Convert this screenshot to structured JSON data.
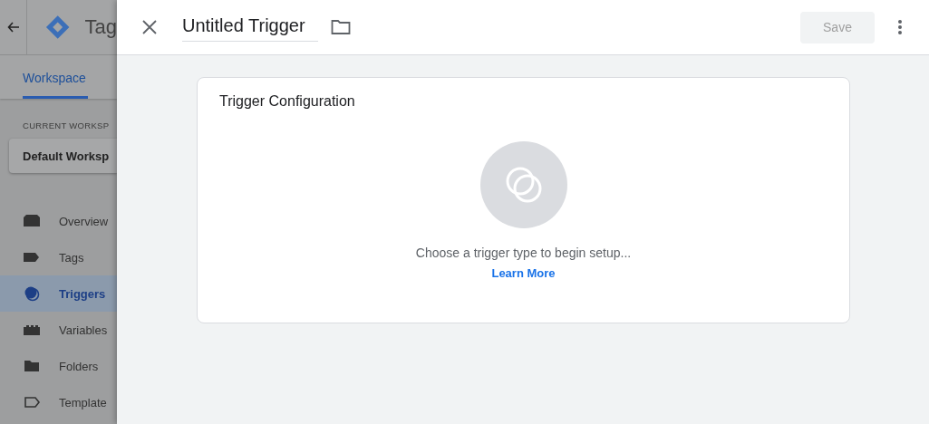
{
  "background_app": {
    "product_name": "Tag",
    "tabs": [
      {
        "label": "Workspace",
        "selected": true
      }
    ],
    "current_workspace_label": "CURRENT WORKSP",
    "workspace_name": "Default Worksp",
    "items": [
      {
        "label": "Overview",
        "kind": "overview",
        "selected": false
      },
      {
        "label": "Tags",
        "kind": "tags",
        "selected": false
      },
      {
        "label": "Triggers",
        "kind": "triggers",
        "selected": true
      },
      {
        "label": "Variables",
        "kind": "variables",
        "selected": false
      },
      {
        "label": "Folders",
        "kind": "folders",
        "selected": false
      },
      {
        "label": "Template",
        "kind": "templates",
        "selected": false
      }
    ]
  },
  "trigger_panel": {
    "title": "Untitled Trigger",
    "save": {
      "label": "Save",
      "disabled": true
    },
    "card": {
      "title": "Trigger Configuration",
      "prompt": "Choose a trigger type to begin setup...",
      "link": "Learn More"
    }
  }
}
